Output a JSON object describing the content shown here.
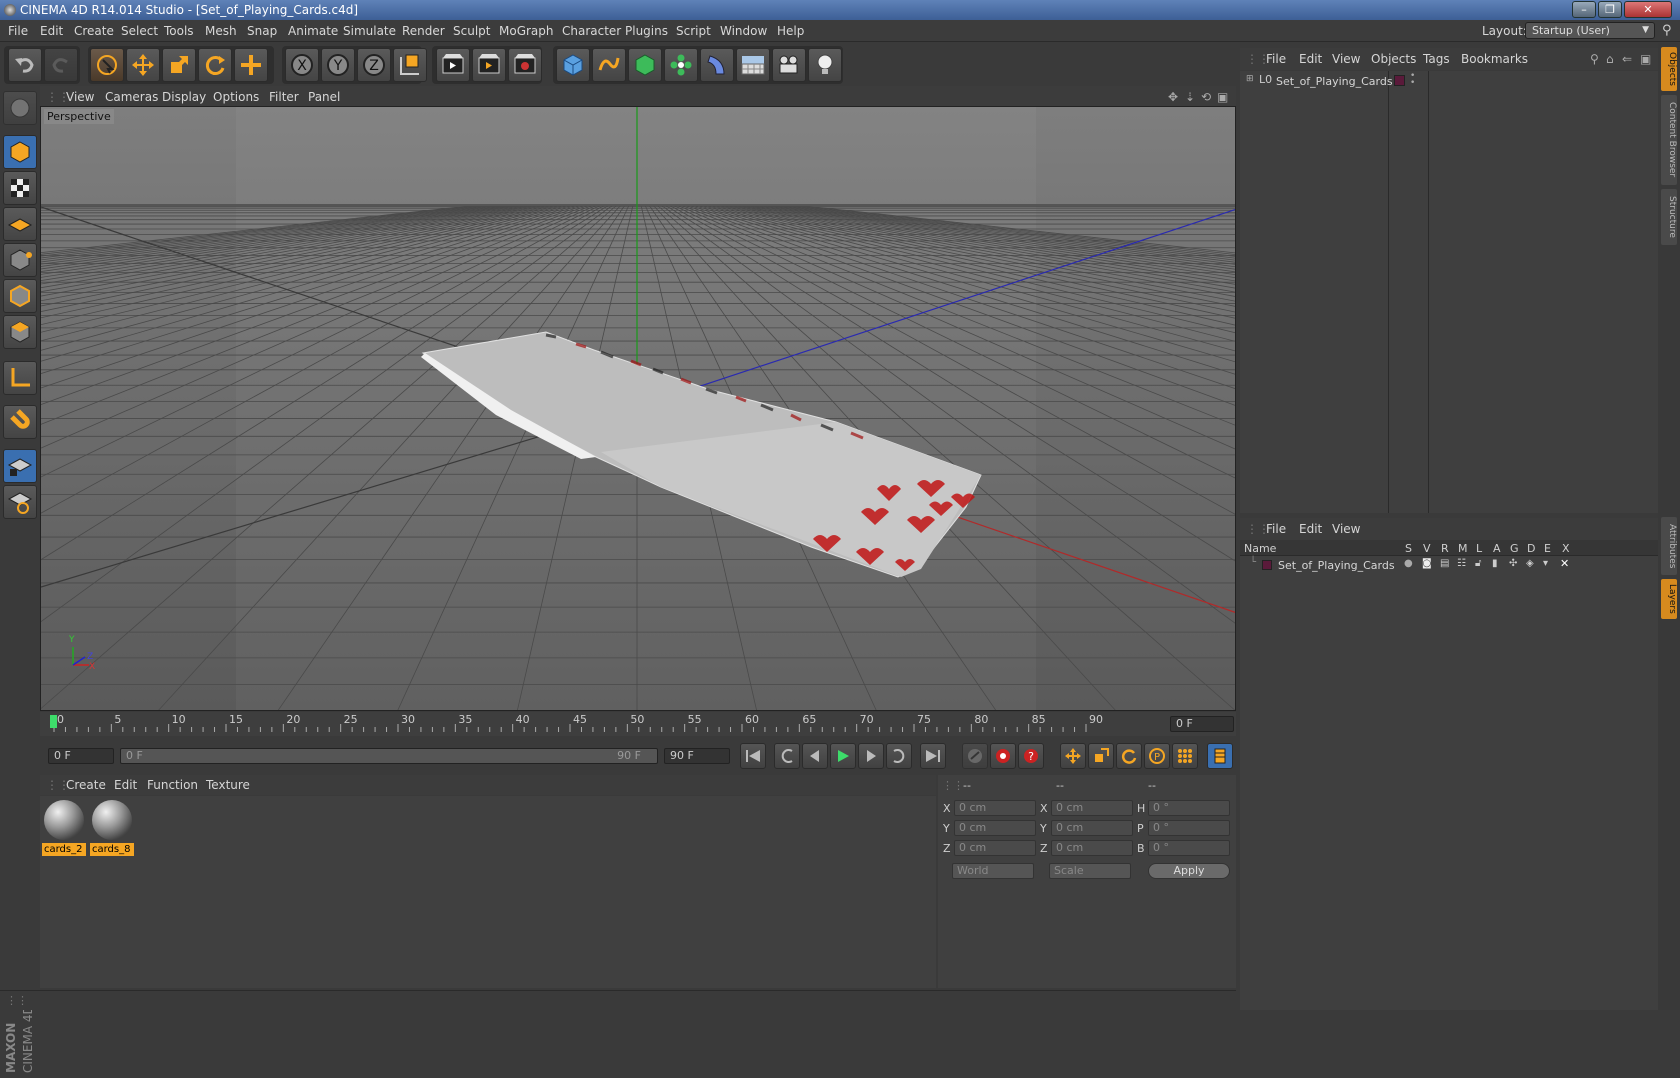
{
  "window": {
    "title": "CINEMA 4D R14.014 Studio - [Set_of_Playing_Cards.c4d]",
    "minimize": "–",
    "maximize": "❐",
    "close": "✕"
  },
  "menubar": {
    "items": [
      "File",
      "Edit",
      "Create",
      "Select",
      "Tools",
      "Mesh",
      "Snap",
      "Animate",
      "Simulate",
      "Render",
      "Sculpt",
      "MoGraph",
      "Character",
      "Plugins",
      "Script",
      "Window",
      "Help"
    ],
    "layout_label": "Layout:",
    "layout_value": "Startup (User)"
  },
  "toolbar": {
    "icons": [
      "undo-icon",
      "redo-icon",
      "live-selection-icon",
      "move-icon",
      "scale-icon",
      "rotate-icon",
      "add-icon",
      "x-axis-icon",
      "y-axis-icon",
      "z-axis-icon",
      "coordinate-system-icon",
      "render-view-icon",
      "render-picture-viewer-icon",
      "edit-render-settings-icon",
      "cube-icon",
      "spline-icon",
      "subdivision-surface-icon",
      "array-icon",
      "deformer-icon",
      "floor-icon",
      "camera-icon",
      "light-icon"
    ]
  },
  "viewport": {
    "menu": [
      "View",
      "Cameras",
      "Display",
      "Options",
      "Filter",
      "Panel"
    ],
    "label": "Perspective",
    "axis_y": "Y",
    "axis_z": "Z",
    "axis_x": "X"
  },
  "timeline": {
    "ticks": [
      "0",
      "5",
      "10",
      "15",
      "20",
      "25",
      "30",
      "35",
      "40",
      "45",
      "50",
      "55",
      "60",
      "65",
      "70",
      "75",
      "80",
      "85",
      "90"
    ],
    "current_frame": "0 F"
  },
  "transport": {
    "start_field": "0 F",
    "range_start": "0 F",
    "range_end": "90 F",
    "end_field": "90 F"
  },
  "materials": {
    "menu": [
      "Create",
      "Edit",
      "Function",
      "Texture"
    ],
    "items": [
      "cards_2",
      "cards_8"
    ]
  },
  "coordinates": {
    "header_1": "--",
    "header_2": "--",
    "header_3": "--",
    "row_x": {
      "label": "X",
      "pos": "0 cm",
      "size_label": "X",
      "size": "0 cm",
      "rot_label": "H",
      "rot": "0 °"
    },
    "row_y": {
      "label": "Y",
      "pos": "0 cm",
      "size_label": "Y",
      "size": "0 cm",
      "rot_label": "P",
      "rot": "0 °"
    },
    "row_z": {
      "label": "Z",
      "pos": "0 cm",
      "size_label": "Z",
      "size": "0 cm",
      "rot_label": "B",
      "rot": "0 °"
    },
    "mode": "World",
    "scale_mode": "Scale",
    "apply": "Apply"
  },
  "objects": {
    "menu": [
      "File",
      "Edit",
      "View",
      "Objects",
      "Tags",
      "Bookmarks"
    ],
    "item": "Set_of_Playing_Cards",
    "layer_color": "#5a1a3a"
  },
  "layers": {
    "menu": [
      "File",
      "Edit",
      "View"
    ],
    "col_name": "Name",
    "col_flags": [
      "S",
      "V",
      "R",
      "M",
      "L",
      "A",
      "G",
      "D",
      "E",
      "X"
    ],
    "item": "Set_of_Playing_Cards"
  },
  "right_tabs": {
    "objects": "Objects",
    "content_browser": "Content Browser",
    "structure": "Structure",
    "attributes": "Attributes",
    "layers": "Layers"
  },
  "branding": {
    "maxon": "MAXON",
    "product": "CINEMA 4D"
  },
  "colors": {
    "accent_orange": "#f5a623",
    "selection_blue": "#3a6fb0"
  }
}
